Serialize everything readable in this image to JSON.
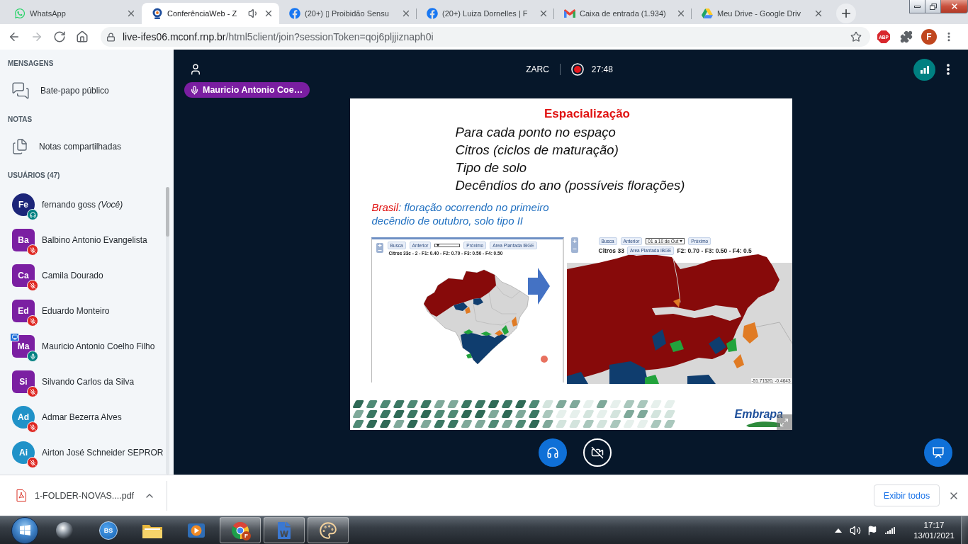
{
  "browser": {
    "tabs": [
      {
        "kind": "whatsapp",
        "title": "WhatsApp",
        "selected": false,
        "playing_audio": false
      },
      {
        "kind": "conference",
        "title": "ConferênciaWeb - Z",
        "selected": true,
        "playing_audio": true
      },
      {
        "kind": "facebook",
        "title": "(20+) ▯ Proibidão Sensu",
        "selected": false,
        "playing_audio": false
      },
      {
        "kind": "facebook",
        "title": "(20+) Luiza Dornelles | F",
        "selected": false,
        "playing_audio": false
      },
      {
        "kind": "gmail",
        "title": "Caixa de entrada (1.934)",
        "selected": false,
        "playing_audio": false
      },
      {
        "kind": "drive",
        "title": "Meu Drive - Google Driv",
        "selected": false,
        "playing_audio": false
      }
    ],
    "nav": [
      {
        "kind": "back",
        "disabled": false
      },
      {
        "kind": "forward",
        "disabled": true
      },
      {
        "kind": "reload",
        "disabled": false
      },
      {
        "kind": "home",
        "disabled": false
      }
    ],
    "address": {
      "host": "live-ifes06.mconf.rnp.br",
      "path": "/html5client/join?sessionToken=qoj6pljjiznaph0i"
    },
    "extensions": [
      {
        "kind": "adblock",
        "label": "ABP"
      },
      {
        "kind": "puzzle"
      }
    ],
    "profile_initial": "F"
  },
  "sidebar": {
    "sections": [
      {
        "title": "MENSAGENS",
        "items": [
          {
            "kind": "chat",
            "label": "Bate-papo público"
          }
        ]
      },
      {
        "title": "NOTAS",
        "items": [
          {
            "kind": "notes",
            "label": "Notas compartilhadas"
          }
        ]
      }
    ],
    "users_title": "USUÁRIOS (47)",
    "users": [
      {
        "initials": "Fe",
        "name": "fernando goss *(Você)*",
        "kind": "circle",
        "color": "#1c2579",
        "listen_only": true,
        "presenter": false
      },
      {
        "initials": "Ba",
        "name": "Balbino Antonio Evangelista",
        "kind": "square",
        "color": "#7b1fa2",
        "listen_only": false,
        "muted": true,
        "presenter": false
      },
      {
        "initials": "Ca",
        "name": "Camila Dourado",
        "kind": "square",
        "color": "#7b1fa2",
        "listen_only": false,
        "muted": true,
        "presenter": false
      },
      {
        "initials": "Ed",
        "name": "Eduardo Monteiro",
        "kind": "square",
        "color": "#7b1fa2",
        "listen_only": false,
        "muted": true,
        "presenter": false
      },
      {
        "initials": "Ma",
        "name": "Mauricio Antonio Coelho Filho",
        "kind": "square",
        "color": "#7b1fa2",
        "listen_only": false,
        "muted": false,
        "presenter": true
      },
      {
        "initials": "Si",
        "name": "Silvando Carlos da Silva",
        "kind": "square",
        "color": "#7b1fa2",
        "listen_only": false,
        "muted": true,
        "presenter": false
      },
      {
        "initials": "Ad",
        "name": "Admar Bezerra Alves",
        "kind": "circle",
        "color": "#2092c8",
        "listen_only": false,
        "muted": true,
        "presenter": false
      },
      {
        "initials": "Ai",
        "name": "Airton José Schneider SEPROR",
        "kind": "circle",
        "color": "#2092c8",
        "listen_only": false,
        "muted": true,
        "presenter": false
      }
    ]
  },
  "meeting": {
    "title": "ZARC",
    "recording": true,
    "elapsed": "27:48",
    "talking": "Mauricio Antonio Coe…",
    "slide": {
      "title": "Espacialização",
      "lines": [
        "Para cada ponto no espaço",
        "Citros (ciclos de maturação)",
        "Tipo de solo",
        "Decêndios do ano (possíveis florações)"
      ],
      "caption": {
        "highlight": "Brasil",
        "text": ": floração ocorrendo no primeiro decêndio de outubro, solo tipo II"
      },
      "maps": [
        {
          "kind": "country",
          "buttons": [
            "Busca",
            "Anterior",
            "Próximo",
            "Area Plantada IBGE"
          ],
          "legend": [
            "Citros 33c - 2 - F1: 0.40 - F2: 0.70 - F3: 0.50 - F4: 0.50"
          ],
          "pointer": true
        },
        {
          "kind": "zoomed",
          "buttons": [
            "Busca",
            "Anterior",
            "Próximo"
          ],
          "period": "01 a 10 de Out",
          "layer_button": "Area Plantada IBGE",
          "legend": [
            "Citros 33",
            "F2: 0.70 - F3: 0.50 - F4: 0.5"
          ],
          "coordinates": "-51.71520, -0.4643"
        }
      ],
      "logo": "Embrapa"
    },
    "controls": [
      {
        "kind": "audio",
        "on": true
      },
      {
        "kind": "camera",
        "on": false
      },
      {
        "kind": "presentation",
        "on": true
      }
    ]
  },
  "downloads": {
    "file": "1-FOLDER-NOVAS....pdf",
    "show_all": "Exibir todos"
  },
  "taskbar": {
    "apps": [
      {
        "kind": "sphere",
        "open": false
      },
      {
        "kind": "bs",
        "label": "BS",
        "open": false
      },
      {
        "kind": "folder",
        "open": false
      },
      {
        "kind": "media",
        "open": false
      },
      {
        "kind": "chrome",
        "badge": "F",
        "open": true
      },
      {
        "kind": "word",
        "open": true
      },
      {
        "kind": "paint",
        "open": true
      }
    ],
    "time": "17:17",
    "date": "13/01/2021"
  }
}
